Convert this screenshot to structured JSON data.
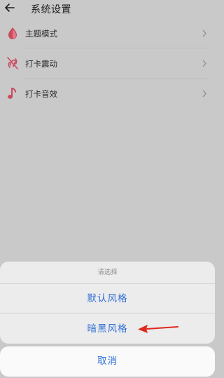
{
  "header": {
    "title": "系统设置",
    "back_icon": "arrow-left-icon"
  },
  "settings": {
    "items": [
      {
        "label": "主题模式",
        "icon": "droplet-icon",
        "icon_color": "#c94a5d"
      },
      {
        "label": "打卡震动",
        "icon": "vibration-off-icon",
        "icon_color": "#c94a5d"
      },
      {
        "label": "打卡音效",
        "icon": "music-note-icon",
        "icon_color": "#c94a5d"
      }
    ]
  },
  "action_sheet": {
    "title": "请选择",
    "options": [
      "默认风格",
      "暗黑风格"
    ],
    "cancel_label": "取消",
    "accent_color": "#2f6fd6"
  },
  "annotation": {
    "arrow_color": "#e0281c",
    "arrow_icon": "red-arrow-icon"
  }
}
